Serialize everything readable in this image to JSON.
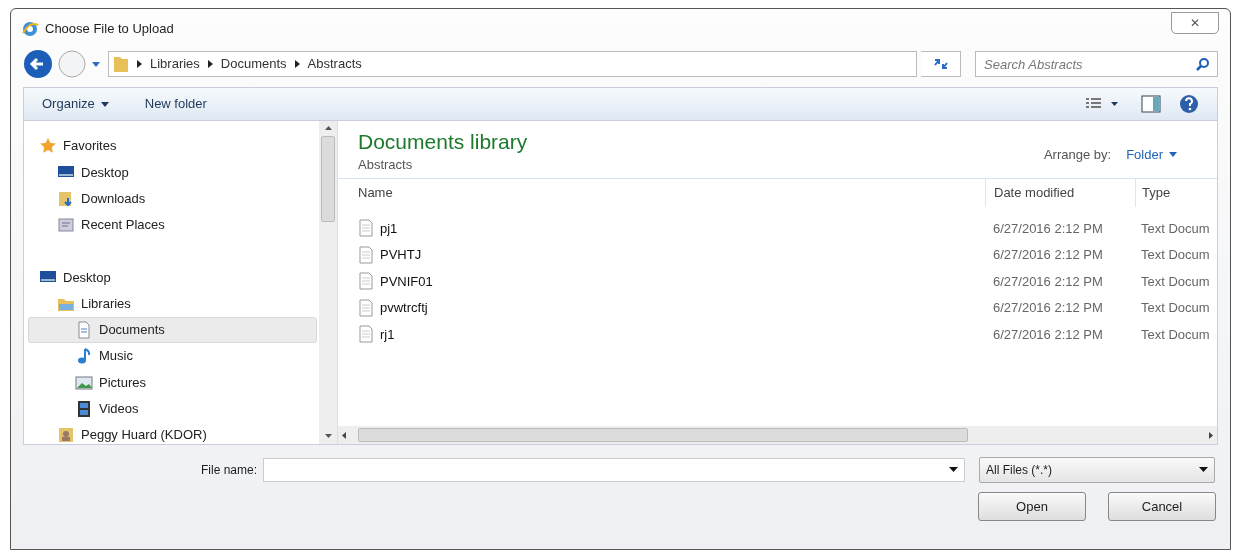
{
  "window": {
    "title": "Choose File to Upload",
    "close": "✕"
  },
  "address": {
    "crumbs": [
      "Libraries",
      "Documents",
      "Abstracts"
    ]
  },
  "search": {
    "placeholder": "Search Abstracts"
  },
  "toolbar": {
    "organize": "Organize",
    "new_folder": "New folder"
  },
  "sidebar": {
    "items": [
      {
        "label": "Favorites",
        "kind": "star",
        "selected": false,
        "children": [
          {
            "label": "Desktop",
            "kind": "desktop",
            "selected": false
          },
          {
            "label": "Downloads",
            "kind": "downloads",
            "selected": false
          },
          {
            "label": "Recent Places",
            "kind": "recent",
            "selected": false
          }
        ]
      },
      {
        "label": "Desktop",
        "kind": "desktop",
        "selected": false,
        "children": [
          {
            "label": "Libraries",
            "kind": "libraries",
            "selected": false,
            "children": [
              {
                "label": "Documents",
                "kind": "documents",
                "selected": true
              },
              {
                "label": "Music",
                "kind": "music",
                "selected": false
              },
              {
                "label": "Pictures",
                "kind": "pictures",
                "selected": false
              },
              {
                "label": "Videos",
                "kind": "videos",
                "selected": false
              }
            ]
          },
          {
            "label": "Peggy Huard (KDOR)",
            "kind": "user",
            "selected": false
          }
        ]
      }
    ]
  },
  "library": {
    "title": "Documents library",
    "subtitle": "Abstracts",
    "arrange_label": "Arrange by:",
    "arrange_value": "Folder"
  },
  "table": {
    "columns": [
      "Name",
      "Date modified",
      "Type"
    ],
    "rows": [
      {
        "name": "pj1",
        "date": "6/27/2016 2:12 PM",
        "type": "Text Docum"
      },
      {
        "name": "PVHTJ",
        "date": "6/27/2016 2:12 PM",
        "type": "Text Docum"
      },
      {
        "name": "PVNIF01",
        "date": "6/27/2016 2:12 PM",
        "type": "Text Docum"
      },
      {
        "name": "pvwtrcftj",
        "date": "6/27/2016 2:12 PM",
        "type": "Text Docum"
      },
      {
        "name": "rj1",
        "date": "6/27/2016 2:12 PM",
        "type": "Text Docum"
      }
    ]
  },
  "file_name": {
    "label": "File name:"
  },
  "filter": {
    "value": "All Files (*.*)"
  },
  "buttons": [
    "Open",
    "Cancel"
  ]
}
